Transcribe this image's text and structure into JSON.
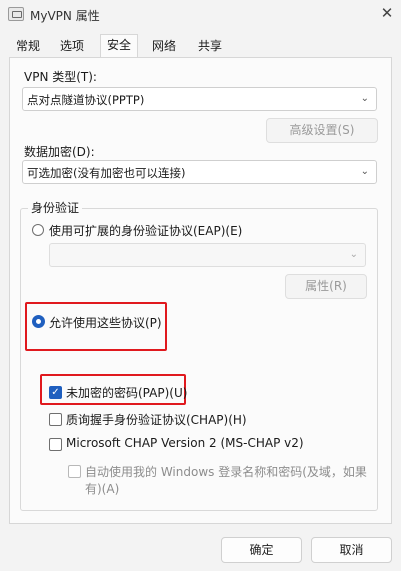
{
  "window": {
    "title": "MyVPN 属性",
    "close_glyph": "✕"
  },
  "tabs": [
    {
      "label": "常规"
    },
    {
      "label": "选项"
    },
    {
      "label": "安全",
      "active": true
    },
    {
      "label": "网络"
    },
    {
      "label": "共享"
    }
  ],
  "security": {
    "vpn_type_label": "VPN 类型(T):",
    "vpn_type_value": "点对点隧道协议(PPTP)",
    "advanced_button": "高级设置(S)",
    "encryption_label": "数据加密(D):",
    "encryption_value": "可选加密(没有加密也可以连接)",
    "auth_group_title": "身份验证",
    "eap_radio_label": "使用可扩展的身份验证协议(EAP)(E)",
    "eap_select_value": "",
    "properties_button": "属性(R)",
    "allow_protocols_label": "允许使用这些协议(P)",
    "pap_label": "未加密的密码(PAP)(U)",
    "chap_label": "质询握手身份验证协议(CHAP)(H)",
    "mschap_label": "Microsoft CHAP Version 2 (MS-CHAP v2)",
    "auto_login_line1": "自动使用我的 Windows 登录名称和密码(及域，如果",
    "auto_login_line2": "有)(A)"
  },
  "states": {
    "eap_selected": false,
    "allow_protocols_selected": true,
    "pap_checked": true,
    "chap_checked": false,
    "mschap_checked": false,
    "auto_login_checked": false
  },
  "footer": {
    "ok_button": "确定",
    "cancel_button": "取消"
  },
  "icons": {
    "chevron": "⌄",
    "check": "✓"
  },
  "colors": {
    "accent": "#1f5fbf",
    "highlight_box": "#e0191e"
  }
}
